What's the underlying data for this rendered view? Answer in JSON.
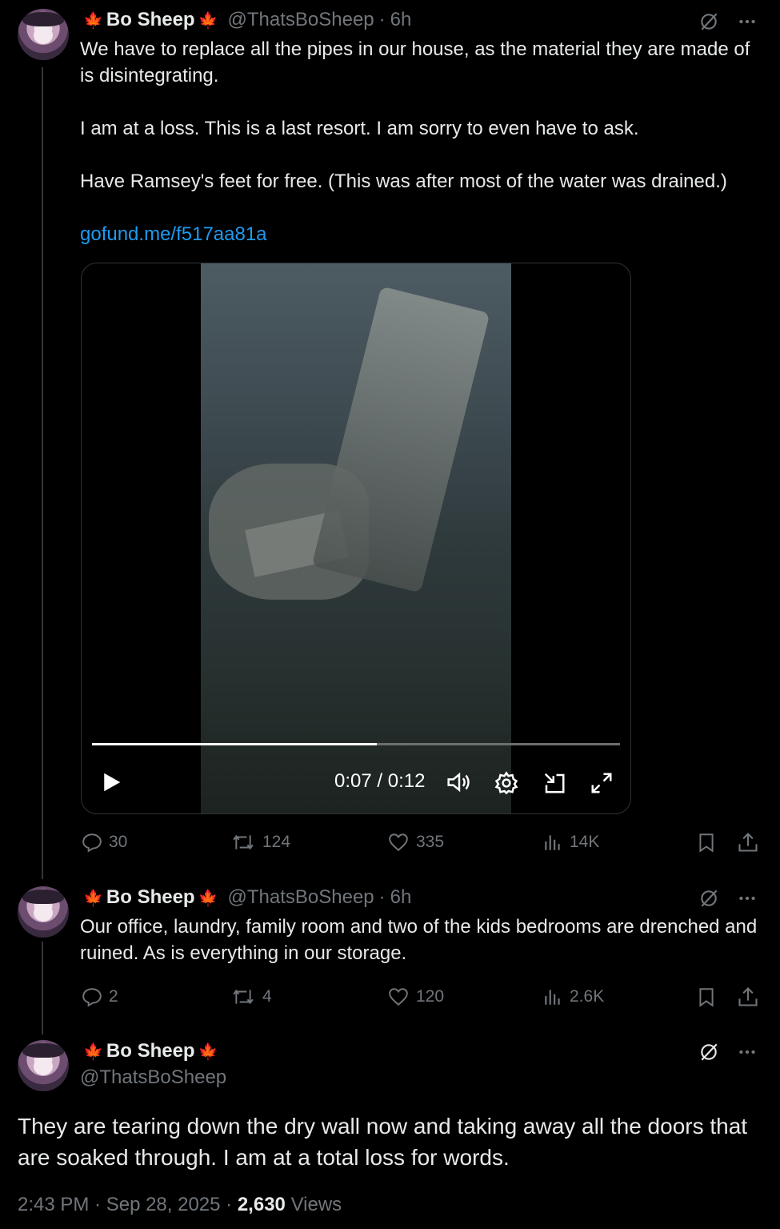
{
  "posts": [
    {
      "display_name": "Bo Sheep",
      "flag": "🍁",
      "handle": "@ThatsBoSheep",
      "separator": "·",
      "time": "6h",
      "paragraphs": [
        "We have to replace all the pipes in our house, as the material they are made of is disintegrating.",
        "I am at a loss. This is a last resort. I am sorry to even have to ask.",
        "Have Ramsey's feet for free. (This was after most of the water was drained.)"
      ],
      "link": "gofund.me/f517aa81a",
      "video": {
        "timecode": "0:07 / 0:12",
        "progress": 0.54
      },
      "stats": {
        "replies": "30",
        "reposts": "124",
        "likes": "335",
        "views": "14K"
      }
    },
    {
      "display_name": "Bo Sheep",
      "flag": "🍁",
      "handle": "@ThatsBoSheep",
      "separator": "·",
      "time": "6h",
      "text": "Our office, laundry, family room and two of the kids bedrooms are drenched and ruined. As is everything in our storage.",
      "stats": {
        "replies": "2",
        "reposts": "4",
        "likes": "120",
        "views": "2.6K"
      }
    },
    {
      "display_name": "Bo Sheep",
      "flag": "🍁",
      "handle": "@ThatsBoSheep",
      "text": "They are tearing down the dry wall now and taking away all the doors that are soaked through. I am at a total loss for words.",
      "timestamp": "2:43 PM · Sep 28, 2025 · ",
      "views_count": "2,630",
      "views_label": "Views"
    }
  ],
  "colors": {
    "background": "#000000",
    "text": "#e7e9ea",
    "muted": "#71767b",
    "link": "#1d9bf0",
    "flag": "#e0242d"
  },
  "icons": [
    "grok-icon",
    "more-icon",
    "reply-icon",
    "repost-icon",
    "like-icon",
    "views-icon",
    "bookmark-icon",
    "share-icon",
    "play-icon",
    "volume-icon",
    "settings-icon",
    "pip-icon",
    "fullscreen-icon"
  ]
}
